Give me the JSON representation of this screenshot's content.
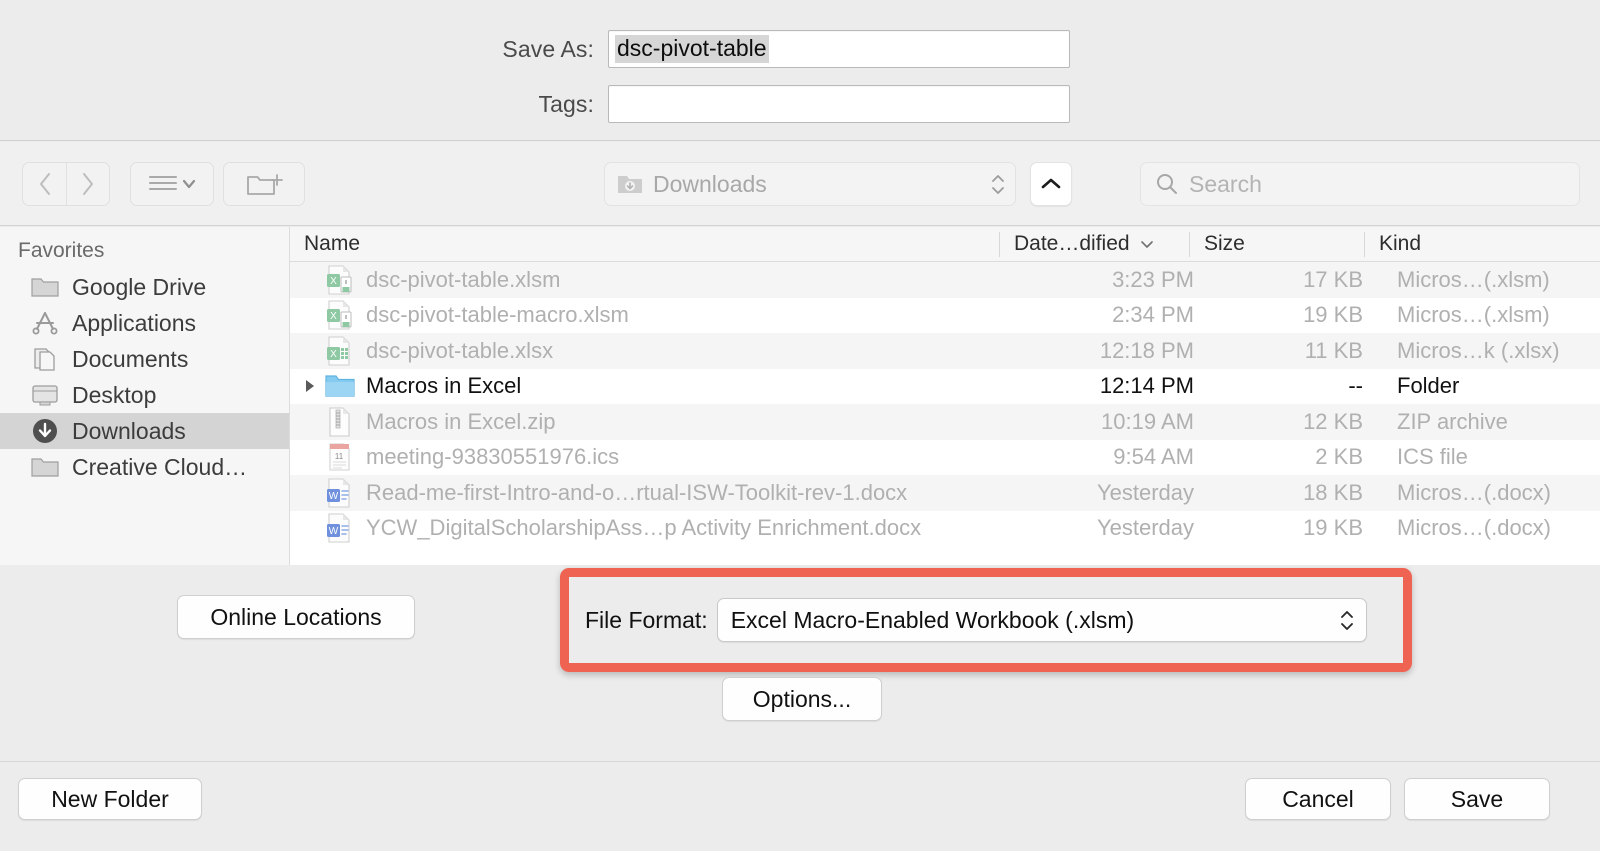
{
  "save_as": {
    "label": "Save As:",
    "value": "dsc-pivot-table"
  },
  "tags": {
    "label": "Tags:",
    "value": "",
    "placeholder": ""
  },
  "toolbar": {
    "back_icon": "chevron-left-icon",
    "forward_icon": "chevron-right-icon",
    "view_icon": "list-view-icon",
    "new_folder_icon": "new-folder-icon",
    "path_value": "Downloads",
    "collapse_icon": "chevron-up-icon",
    "search_placeholder": "Search"
  },
  "sidebar": {
    "header": "Favorites",
    "items": [
      {
        "label": "Google Drive",
        "icon": "folder-icon",
        "selected": false
      },
      {
        "label": "Applications",
        "icon": "applications-icon",
        "selected": false
      },
      {
        "label": "Documents",
        "icon": "documents-icon",
        "selected": false
      },
      {
        "label": "Desktop",
        "icon": "desktop-icon",
        "selected": false
      },
      {
        "label": "Downloads",
        "icon": "downloads-icon",
        "selected": true
      },
      {
        "label": "Creative Cloud…",
        "icon": "folder-icon",
        "selected": false
      }
    ]
  },
  "file_list": {
    "columns": {
      "name": "Name",
      "date": "Date…dified",
      "size": "Size",
      "kind": "Kind",
      "sort_icon": "chevron-down-icon"
    },
    "rows": [
      {
        "name": "dsc-pivot-table.xlsm",
        "date": "3:23 PM",
        "size": "17 KB",
        "kind": "Micros…(.xlsm)",
        "icon": "excel-macro-file-icon",
        "enabled": false,
        "disclosure": false
      },
      {
        "name": "dsc-pivot-table-macro.xlsm",
        "date": "2:34 PM",
        "size": "19 KB",
        "kind": "Micros…(.xlsm)",
        "icon": "excel-macro-file-icon",
        "enabled": false,
        "disclosure": false
      },
      {
        "name": "dsc-pivot-table.xlsx",
        "date": "12:18 PM",
        "size": "11 KB",
        "kind": "Micros…k (.xlsx)",
        "icon": "excel-file-icon",
        "enabled": false,
        "disclosure": false
      },
      {
        "name": "Macros in Excel",
        "date": "12:14 PM",
        "size": "--",
        "kind": "Folder",
        "icon": "folder-blue-icon",
        "enabled": true,
        "disclosure": true
      },
      {
        "name": "Macros in Excel.zip",
        "date": "10:19 AM",
        "size": "12 KB",
        "kind": "ZIP archive",
        "icon": "zip-file-icon",
        "enabled": false,
        "disclosure": false
      },
      {
        "name": "meeting-93830551976.ics",
        "date": "9:54 AM",
        "size": "2 KB",
        "kind": "ICS file",
        "icon": "calendar-file-icon",
        "enabled": false,
        "disclosure": false
      },
      {
        "name": "Read-me-first-Intro-and-o…rtual-ISW-Toolkit-rev-1.docx",
        "date": "Yesterday",
        "size": "18 KB",
        "kind": "Micros…(.docx)",
        "icon": "word-file-icon",
        "enabled": false,
        "disclosure": false
      },
      {
        "name": "YCW_DigitalScholarshipAss…p Activity Enrichment.docx",
        "date": "Yesterday",
        "size": "19 KB",
        "kind": "Micros…(.docx)",
        "icon": "word-file-icon",
        "enabled": false,
        "disclosure": false
      }
    ]
  },
  "options_area": {
    "online_locations_label": "Online Locations",
    "file_format_label": "File Format:",
    "file_format_value": "Excel Macro-Enabled Workbook (.xlsm)",
    "options_label": "Options...",
    "highlight_color": "#ee6352"
  },
  "bottom_bar": {
    "new_folder_label": "New Folder",
    "cancel_label": "Cancel",
    "save_label": "Save"
  }
}
